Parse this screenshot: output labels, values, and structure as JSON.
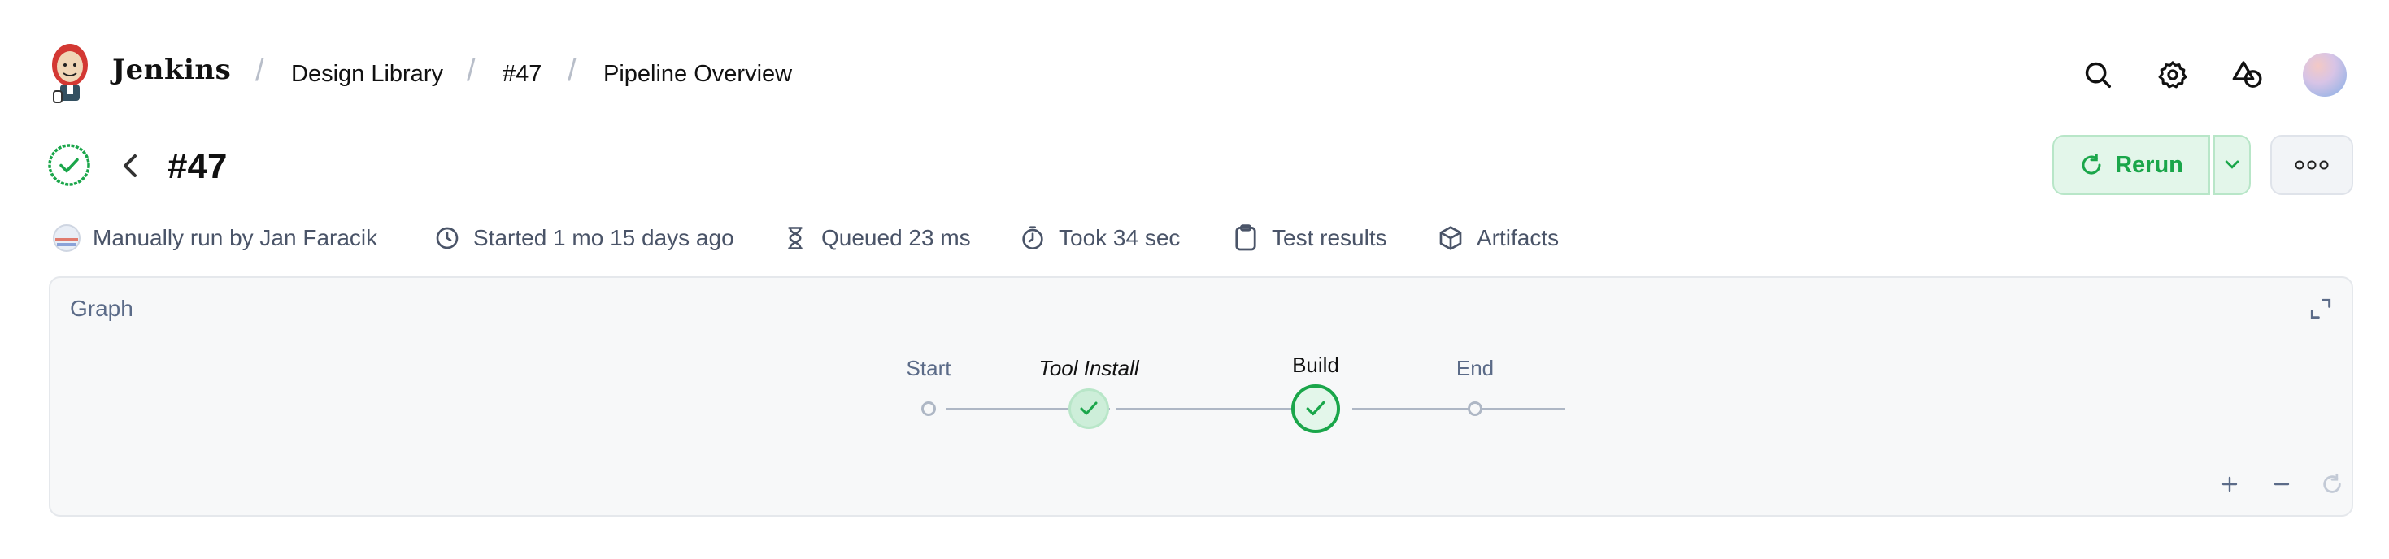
{
  "header": {
    "brand": "Jenkins",
    "breadcrumbs": [
      "Design Library",
      "#47",
      "Pipeline Overview"
    ],
    "icons": [
      "search-icon",
      "gear-icon",
      "shapes-icon",
      "avatar"
    ]
  },
  "run": {
    "title": "#47",
    "status": "success",
    "rerun_label": "Rerun"
  },
  "meta": {
    "trigger": "Manually run by Jan Faracik",
    "started": "Started 1 mo 15 days ago",
    "queued": "Queued 23 ms",
    "took": "Took 34 sec",
    "tests": "Test results",
    "artifacts": "Artifacts"
  },
  "graph": {
    "title": "Graph",
    "nodes": [
      {
        "label": "Start",
        "state": "start"
      },
      {
        "label": "Tool Install",
        "state": "success"
      },
      {
        "label": "Build",
        "state": "success"
      },
      {
        "label": "End",
        "state": "end"
      }
    ]
  },
  "colors": {
    "accent_green": "#1aa64a",
    "success_bg": "#e3f6ea",
    "muted": "#5b6b88"
  }
}
